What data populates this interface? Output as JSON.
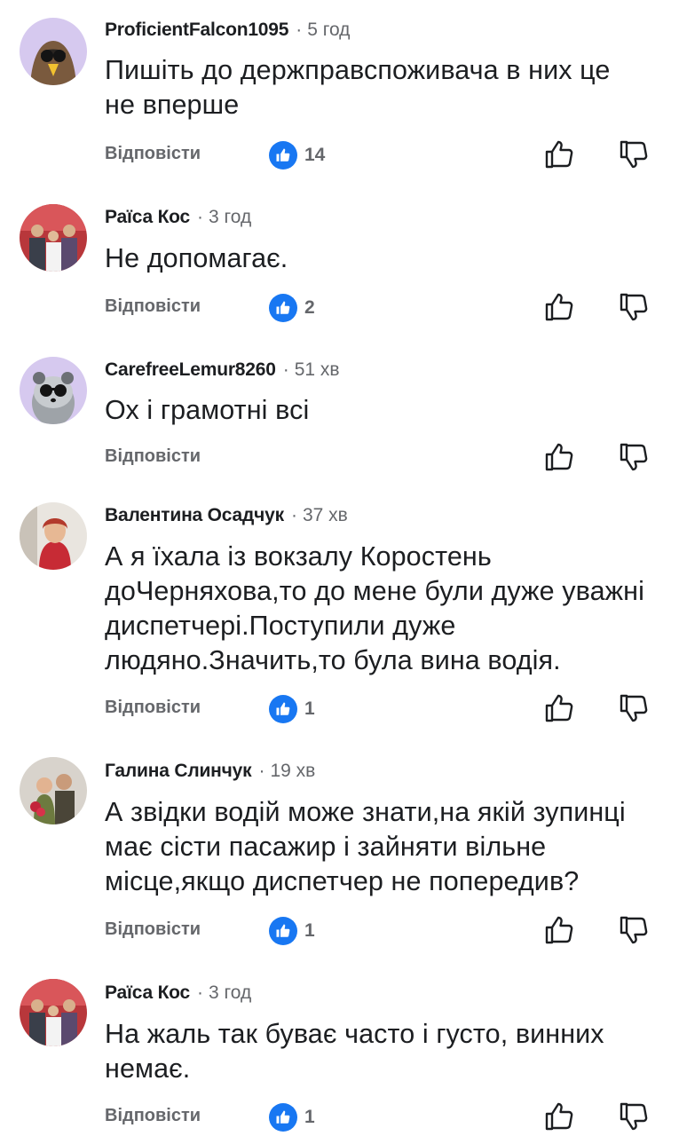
{
  "colors": {
    "accent": "#1877f2",
    "meta": "#65676b",
    "text": "#1c1e21"
  },
  "comments": [
    {
      "author": "ProficientFalcon1095",
      "time": "5 год",
      "avatar": "falcon-avatar",
      "lines": [
        "Пишіть до держправспоживача в них це",
        "не вперше"
      ],
      "reply": "Відповісти",
      "likes": "14"
    },
    {
      "author": "Раїса Кос",
      "time": "3 год",
      "avatar": "photo-avatar",
      "lines": [
        "Не допомагає."
      ],
      "reply": "Відповісти",
      "likes": "2"
    },
    {
      "author": "CarefreeLemur8260",
      "time": "51 хв",
      "avatar": "lemur-avatar",
      "lines": [
        "Ох і грамотні всі"
      ],
      "reply": "Відповісти",
      "likes": ""
    },
    {
      "author": "Валентина Осадчук",
      "time": "37 хв",
      "avatar": "photo-avatar",
      "lines": [
        "А я їхала із вокзалу Коростень",
        "доЧерняхова,то до мене були дуже уважні",
        "диспетчері.Поступили дуже",
        "людяно.Значить,то була вина водія."
      ],
      "reply": "Відповісти",
      "likes": "1"
    },
    {
      "author": "Галина Слинчук",
      "time": "19 хв",
      "avatar": "photo-avatar",
      "lines": [
        "А звідки водій може знати,на якій зупинці",
        "має сісти пасажир і зайняти вільне",
        "місце,якщо диспетчер не попередив?"
      ],
      "reply": "Відповісти",
      "likes": "1"
    },
    {
      "author": "Раїса Кос",
      "time": "3 год",
      "avatar": "photo-avatar",
      "lines": [
        "На жаль так буває часто і густо, винних",
        "немає."
      ],
      "reply": "Відповісти",
      "likes": "1"
    }
  ]
}
